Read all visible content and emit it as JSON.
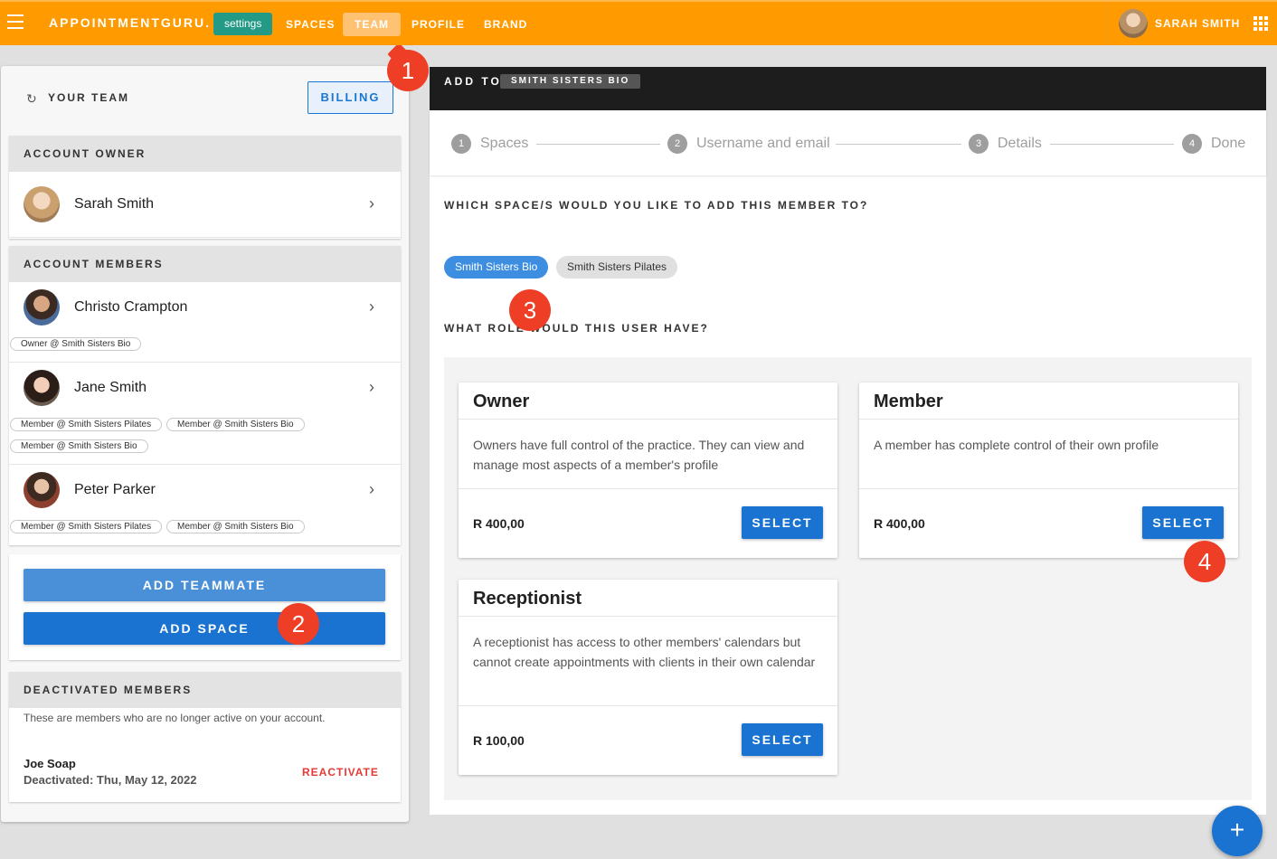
{
  "topbar": {
    "brand": "APPOINTMENTGURU.",
    "settings": "settings",
    "nav": [
      "SPACES",
      "TEAM",
      "PROFILE",
      "BRAND"
    ],
    "user_name": "SARAH SMITH"
  },
  "team": {
    "title": "YOUR TEAM",
    "billing": "BILLING",
    "owner_header": "ACCOUNT OWNER",
    "owner_name": "Sarah Smith",
    "members_header": "ACCOUNT MEMBERS",
    "members": [
      {
        "name": "Christo Crampton",
        "roles": [
          "Owner @ Smith Sisters Bio"
        ]
      },
      {
        "name": "Jane Smith",
        "roles": [
          "Member @ Smith Sisters Pilates",
          "Member @ Smith Sisters Bio",
          "Member @ Smith Sisters Bio"
        ]
      },
      {
        "name": "Peter Parker",
        "roles": [
          "Member @ Smith Sisters Pilates",
          "Member @ Smith Sisters Bio"
        ]
      }
    ],
    "add_teammate": "ADD TEAMMATE",
    "add_space": "ADD SPACE",
    "deactivated_header": "DEACTIVATED MEMBERS",
    "deactivated_desc": "These are members who are no longer active on your account.",
    "deactivated_name": "Joe Soap",
    "deactivated_date": "Deactivated: Thu, May 12, 2022",
    "reactivate": "REACTIVATE"
  },
  "add": {
    "label": "ADD TO",
    "space": "SMITH SISTERS BIO",
    "steps": [
      {
        "num": "1",
        "label": "Spaces"
      },
      {
        "num": "2",
        "label": "Username and email"
      },
      {
        "num": "3",
        "label": "Details"
      },
      {
        "num": "4",
        "label": "Done"
      }
    ],
    "space_question": "WHICH SPACE/S WOULD YOU LIKE TO ADD THIS MEMBER TO?",
    "spaces": [
      "Smith Sisters Bio",
      "Smith Sisters Pilates"
    ],
    "role_question": "WHAT ROLE WOULD THIS USER HAVE?",
    "roles": [
      {
        "title": "Owner",
        "desc": "Owners have full control of the practice. They can view and manage most aspects of a member's profile",
        "price": "R 400,00",
        "button": "SELECT"
      },
      {
        "title": "Member",
        "desc": "A member has complete control of their own profile",
        "price": "R 400,00",
        "button": "SELECT"
      },
      {
        "title": "Receptionist",
        "desc": "A receptionist has access to other members' calendars but cannot create appointments with clients in their own calendar",
        "price": "R 100,00",
        "button": "SELECT"
      }
    ]
  },
  "fab": "+",
  "markers": [
    "1",
    "2",
    "3",
    "4"
  ],
  "colors": {
    "topbar": "#ff9b00",
    "primary": "#1a73d0",
    "marker": "#ee3e26"
  }
}
